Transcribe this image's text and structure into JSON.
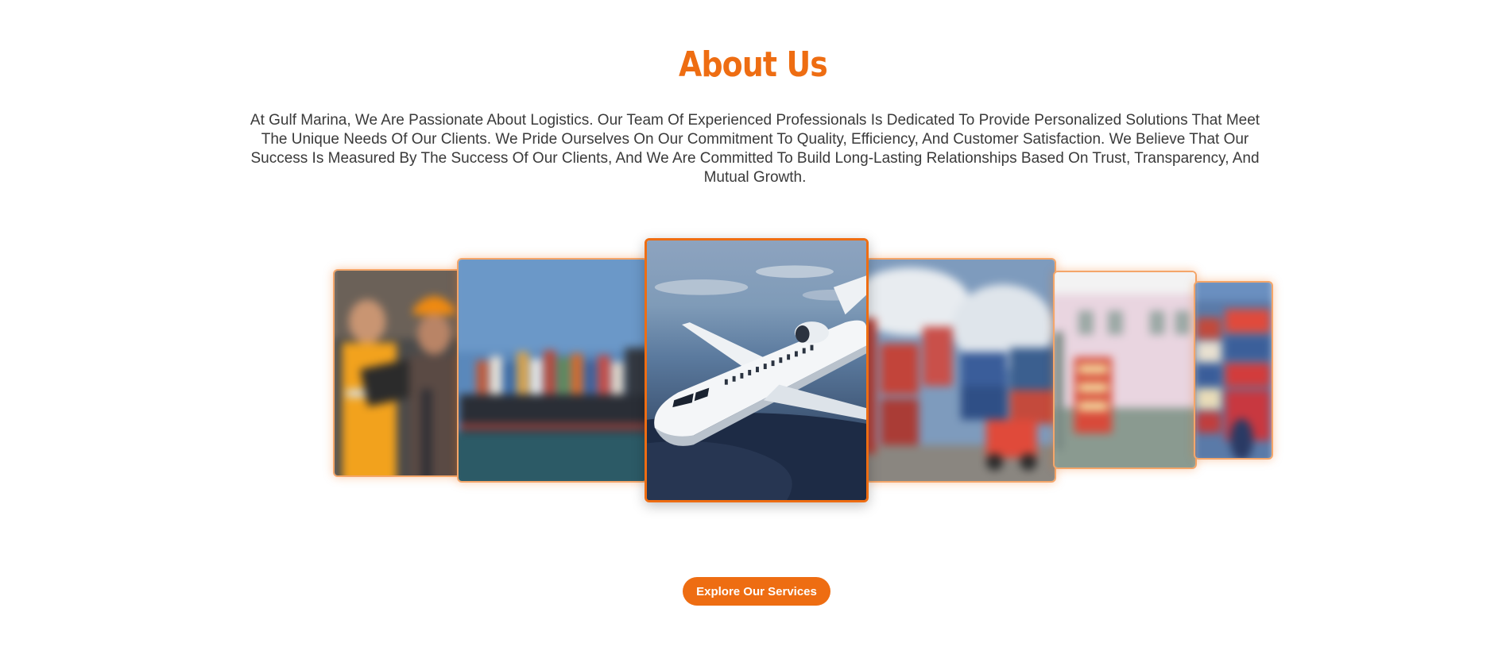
{
  "about": {
    "title": "About Us",
    "description": "At Gulf Marina, We Are Passionate About Logistics. Our Team Of Experienced Professionals Is Dedicated To Provide Personalized Solutions That Meet The Unique Needs Of Our Clients. We Pride Ourselves On Our Commitment To Quality, Efficiency, And Customer Satisfaction. We Believe That Our Success Is Measured By The Success Of Our Clients, And We Are Committed To Build Long-Lasting Relationships Based On Trust, Transparency, And Mutual Growth."
  },
  "carousel": {
    "slides": [
      {
        "subject": "workers with laptop and hard hat",
        "active": false
      },
      {
        "subject": "container ship at sea",
        "active": false
      },
      {
        "subject": "airplane flying over city",
        "active": true
      },
      {
        "subject": "shipping containers at port",
        "active": false
      },
      {
        "subject": "warehouse with cargo",
        "active": false
      },
      {
        "subject": "stacked containers",
        "active": false
      }
    ]
  },
  "cta": {
    "label": "Explore Our Services"
  },
  "colors": {
    "accent": "#ee6d12",
    "text": "#3a3a3a",
    "background": "#ffffff"
  }
}
